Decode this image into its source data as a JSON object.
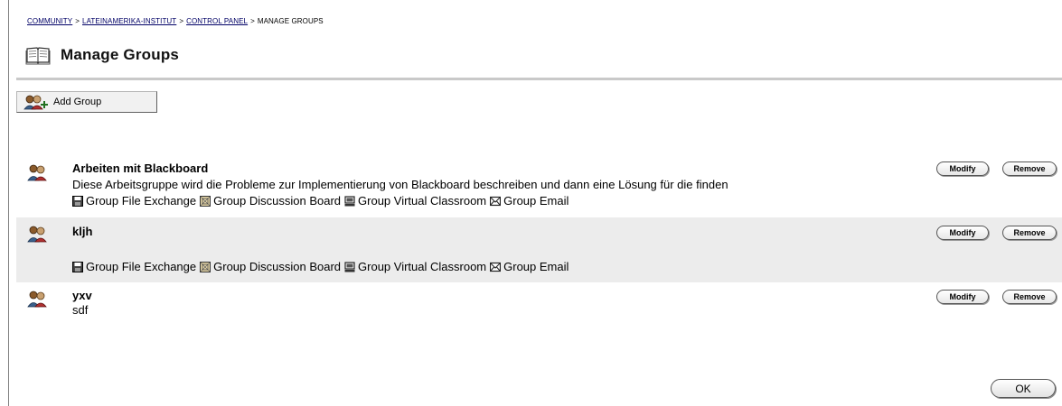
{
  "breadcrumb": {
    "items": [
      "COMMUNITY",
      "LATEINAMERIKA-INSTITUT",
      "CONTROL PANEL"
    ],
    "separator": ">",
    "current": "MANAGE GROUPS"
  },
  "page": {
    "title": "Manage Groups"
  },
  "actions": {
    "add_group_label": "Add Group"
  },
  "tools": {
    "file_exchange": "Group File Exchange",
    "discussion_board": "Group Discussion Board",
    "virtual_classroom": "Group Virtual Classroom",
    "email": "Group Email"
  },
  "row_buttons": {
    "modify": "Modify",
    "remove": "Remove"
  },
  "groups": [
    {
      "name": "Arbeiten mit Blackboard",
      "description": "Diese Arbeitsgruppe wird die Probleme zur Implementierung von Blackboard beschreiben und dann eine Lösung für die finden"
    },
    {
      "name": "kljh",
      "description": ""
    },
    {
      "name": "yxv",
      "description": "sdf"
    }
  ],
  "footer": {
    "ok_label": "OK"
  },
  "colors": {
    "breadcrumb_link": "#000066",
    "row_shade": "#ececec",
    "rule": "#c9c9c9"
  }
}
